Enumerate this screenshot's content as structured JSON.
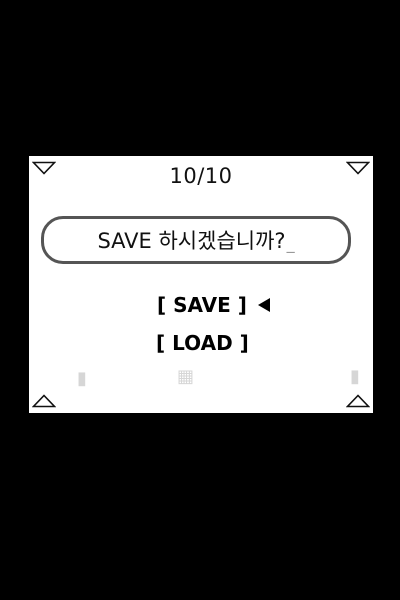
{
  "dialog": {
    "page_counter": "10/10",
    "prompt": "SAVE 하시겠습니까?",
    "cursor": "_"
  },
  "menu": {
    "items": [
      {
        "label": "[ SAVE ]",
        "selected": true
      },
      {
        "label": "[ LOAD ]",
        "selected": false
      }
    ]
  },
  "colors": {
    "background": "#000000",
    "panel": "#ffffff",
    "text": "#111111",
    "prompt_border": "#555555"
  },
  "icons": {
    "corners": [
      "triangle-down-icon",
      "triangle-down-icon",
      "triangle-up-icon",
      "triangle-up-icon"
    ],
    "selector": "triangle-left-icon"
  }
}
